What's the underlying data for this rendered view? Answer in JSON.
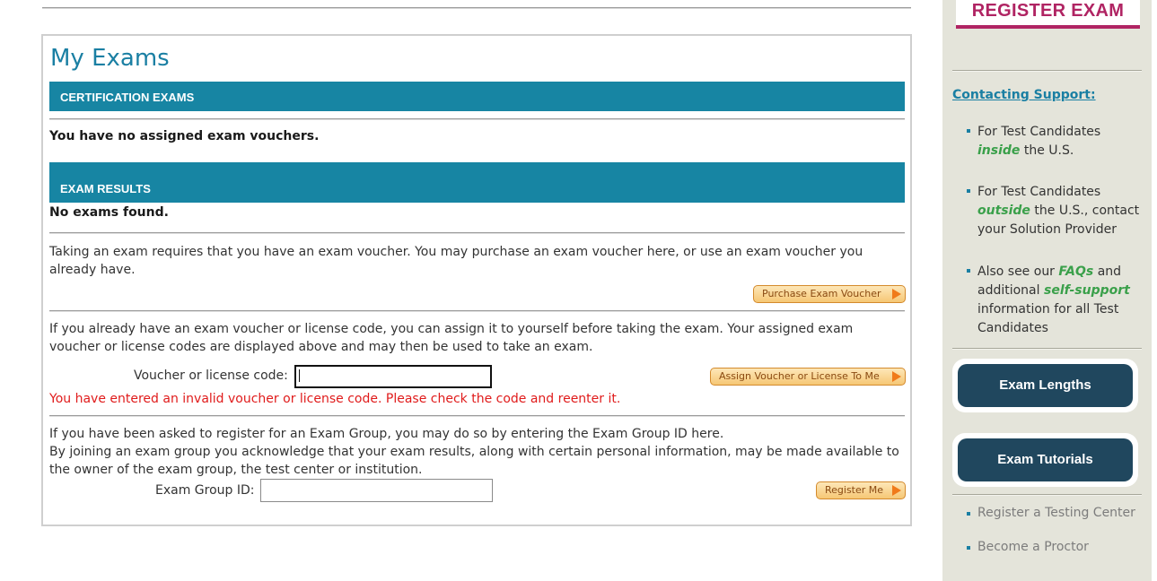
{
  "main": {
    "title": "My Exams",
    "certification_header": "CERTIFICATION EXAMS",
    "no_vouchers": "You have no assigned exam vouchers.",
    "results_header": "EXAM RESULTS",
    "no_exams": "No exams found.",
    "purchase_text": "Taking an exam requires that you have an exam voucher. You may purchase an exam voucher here, or use an exam voucher you already have.",
    "purchase_button": "Purchase Exam Voucher",
    "assign_text": "If you already have an exam voucher or license code, you can assign it to yourself before taking the exam. Your assigned exam voucher or license codes are displayed above and may then be used to take an exam.",
    "voucher_label": "Voucher or license code:",
    "voucher_value": "",
    "assign_button": "Assign Voucher or License To Me",
    "error_message": "You have entered an invalid voucher or license code. Please check the code and reenter it.",
    "group_text_1": "If you have been asked to register for an Exam Group, you may do so by entering the Exam Group ID here.",
    "group_text_2": "By joining an exam group you acknowledge that your exam results, along with certain personal information, may be made available to the owner of the exam group, the test center or institution.",
    "group_label": "Exam Group ID:",
    "group_value": "",
    "register_button": "Register Me"
  },
  "sidebar": {
    "register_exam": "REGISTER EXAM",
    "support_heading": "Contacting Support:",
    "items": [
      {
        "pre": "For Test Candidates",
        "em": "inside",
        "post": "the U.S."
      },
      {
        "pre": "For Test Candidates",
        "em": "outside",
        "post": "the U.S., contact your Solution Provider"
      },
      {
        "pre": "Also see our",
        "em": "FAQs",
        "mid": "and additional",
        "em2": "self-support",
        "post": "information for all Test Candidates"
      }
    ],
    "exam_lengths": "Exam Lengths",
    "exam_tutorials": "Exam Tutorials",
    "links": [
      "Register a Testing Center",
      "Become a Proctor"
    ]
  },
  "colors": {
    "accent": "#1785a3",
    "error": "#e01b1b",
    "register_exam": "#b02463",
    "dark_button": "#20475e",
    "green_emphasis": "#3aa04a"
  }
}
